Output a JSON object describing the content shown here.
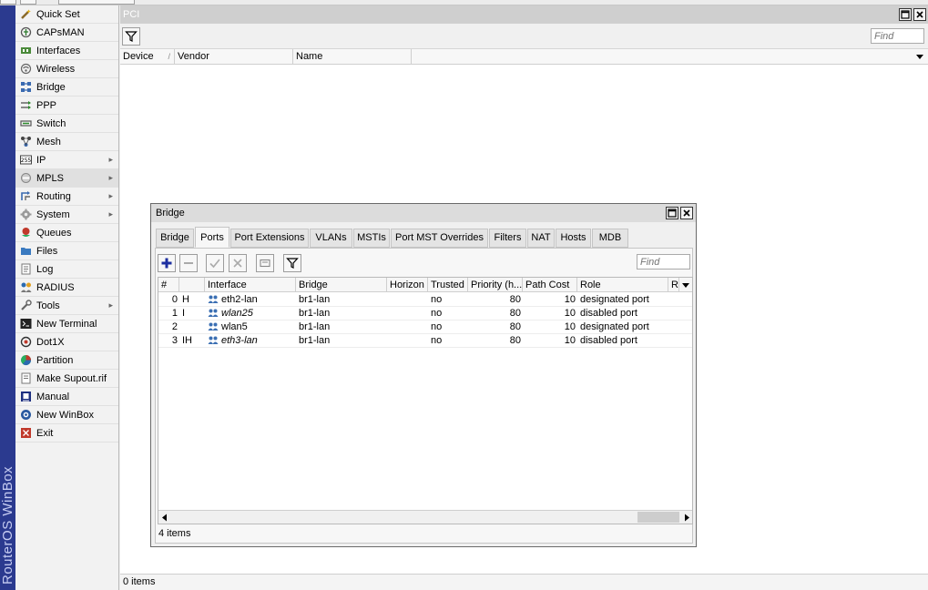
{
  "sidebar": {
    "brand": "RouterOS WinBox",
    "items": [
      {
        "label": "Quick Set",
        "icon": "wand-icon",
        "arrow": false
      },
      {
        "label": "CAPsMAN",
        "icon": "capsman-icon",
        "arrow": false
      },
      {
        "label": "Interfaces",
        "icon": "interfaces-icon",
        "arrow": false
      },
      {
        "label": "Wireless",
        "icon": "wireless-icon",
        "arrow": false
      },
      {
        "label": "Bridge",
        "icon": "bridge-icon",
        "arrow": false
      },
      {
        "label": "PPP",
        "icon": "ppp-icon",
        "arrow": false
      },
      {
        "label": "Switch",
        "icon": "switch-icon",
        "arrow": false
      },
      {
        "label": "Mesh",
        "icon": "mesh-icon",
        "arrow": false
      },
      {
        "label": "IP",
        "icon": "ip-icon",
        "arrow": true
      },
      {
        "label": "MPLS",
        "icon": "mpls-icon",
        "arrow": true
      },
      {
        "label": "Routing",
        "icon": "routing-icon",
        "arrow": true
      },
      {
        "label": "System",
        "icon": "gear-icon",
        "arrow": true
      },
      {
        "label": "Queues",
        "icon": "queues-icon",
        "arrow": false
      },
      {
        "label": "Files",
        "icon": "folder-icon",
        "arrow": false
      },
      {
        "label": "Log",
        "icon": "log-icon",
        "arrow": false
      },
      {
        "label": "RADIUS",
        "icon": "radius-icon",
        "arrow": false
      },
      {
        "label": "Tools",
        "icon": "tools-icon",
        "arrow": true
      },
      {
        "label": "New Terminal",
        "icon": "terminal-icon",
        "arrow": false
      },
      {
        "label": "Dot1X",
        "icon": "dot1x-icon",
        "arrow": false
      },
      {
        "label": "Partition",
        "icon": "partition-icon",
        "arrow": false
      },
      {
        "label": "Make Supout.rif",
        "icon": "supout-icon",
        "arrow": false
      },
      {
        "label": "Manual",
        "icon": "manual-icon",
        "arrow": false
      },
      {
        "label": "New WinBox",
        "icon": "winbox-icon",
        "arrow": false
      },
      {
        "label": "Exit",
        "icon": "exit-icon",
        "arrow": false
      }
    ]
  },
  "pci": {
    "title": "PCI",
    "find_placeholder": "Find",
    "columns": [
      "Device",
      "Vendor",
      "Name"
    ],
    "status": "0 items"
  },
  "bridge": {
    "title": "Bridge",
    "tabs": [
      "Bridge",
      "Ports",
      "Port Extensions",
      "VLANs",
      "MSTIs",
      "Port MST Overrides",
      "Filters",
      "NAT",
      "Hosts",
      "MDB"
    ],
    "active_tab": "Ports",
    "find_placeholder": "Find",
    "columns": [
      "#",
      "",
      "Interface",
      "Bridge",
      "Horizon",
      "Trusted",
      "Priority (h...",
      "Path Cost",
      "Role",
      "R"
    ],
    "rows": [
      {
        "num": "0",
        "flags": "H",
        "interface": "eth2-lan",
        "bridge": "br1-lan",
        "horizon": "",
        "trusted": "no",
        "priority": "80",
        "path_cost": "10",
        "role": "designated port",
        "italic": false
      },
      {
        "num": "1",
        "flags": "I",
        "interface": "wlan25",
        "bridge": "br1-lan",
        "horizon": "",
        "trusted": "no",
        "priority": "80",
        "path_cost": "10",
        "role": "disabled port",
        "italic": true
      },
      {
        "num": "2",
        "flags": "",
        "interface": "wlan5",
        "bridge": "br1-lan",
        "horizon": "",
        "trusted": "no",
        "priority": "80",
        "path_cost": "10",
        "role": "designated port",
        "italic": false
      },
      {
        "num": "3",
        "flags": "IH",
        "interface": "eth3-lan",
        "bridge": "br1-lan",
        "horizon": "",
        "trusted": "no",
        "priority": "80",
        "path_cost": "10",
        "role": "disabled port",
        "italic": true
      }
    ],
    "status": "4 items"
  },
  "colors": {
    "brand_bar": "#2b3a8f",
    "add_button": "#1d2fa0",
    "interface_icon": "#3b6fb3"
  }
}
